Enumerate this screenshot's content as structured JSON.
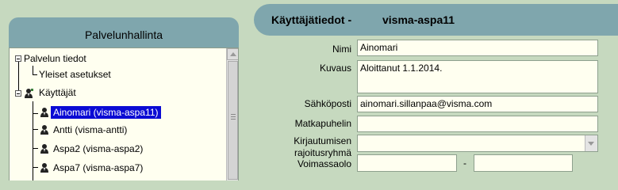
{
  "left_panel": {
    "title": "Palvelunhallinta",
    "tree": {
      "service_info": "Palvelun tiedot",
      "general_settings": "Yleiset asetukset",
      "users": "Käyttäjät",
      "user_items": [
        "Ainomari (visma-aspa11)",
        "Antti (visma-antti)",
        "Aspa2 (visma-aspa2)",
        "Aspa7 (visma-aspa7)"
      ],
      "selected_index": 0
    }
  },
  "right_panel": {
    "header_prefix": "Käyttäjätiedot -",
    "header_user": "visma-aspa11",
    "fields": {
      "name_label": "Nimi",
      "name_value": "Ainomari",
      "desc_label": "Kuvaus",
      "desc_value": "Aloittanut 1.1.2014.",
      "email_label": "Sähköposti",
      "email_value": "ainomari.sillanpaa@visma.com",
      "mobile_label": "Matkapuhelin",
      "mobile_value": "",
      "login_group_label_1": "Kirjautumisen",
      "login_group_label_2": "rajoitusryhmä",
      "login_group_value": "",
      "validity_label": "Voimassaolo",
      "validity_from": "",
      "validity_sep": "-",
      "validity_to": ""
    }
  },
  "colors": {
    "background": "#c6d9bf",
    "header": "#7fa6ad",
    "field_bg": "#fffff0",
    "selection": "#0b0bd4"
  }
}
